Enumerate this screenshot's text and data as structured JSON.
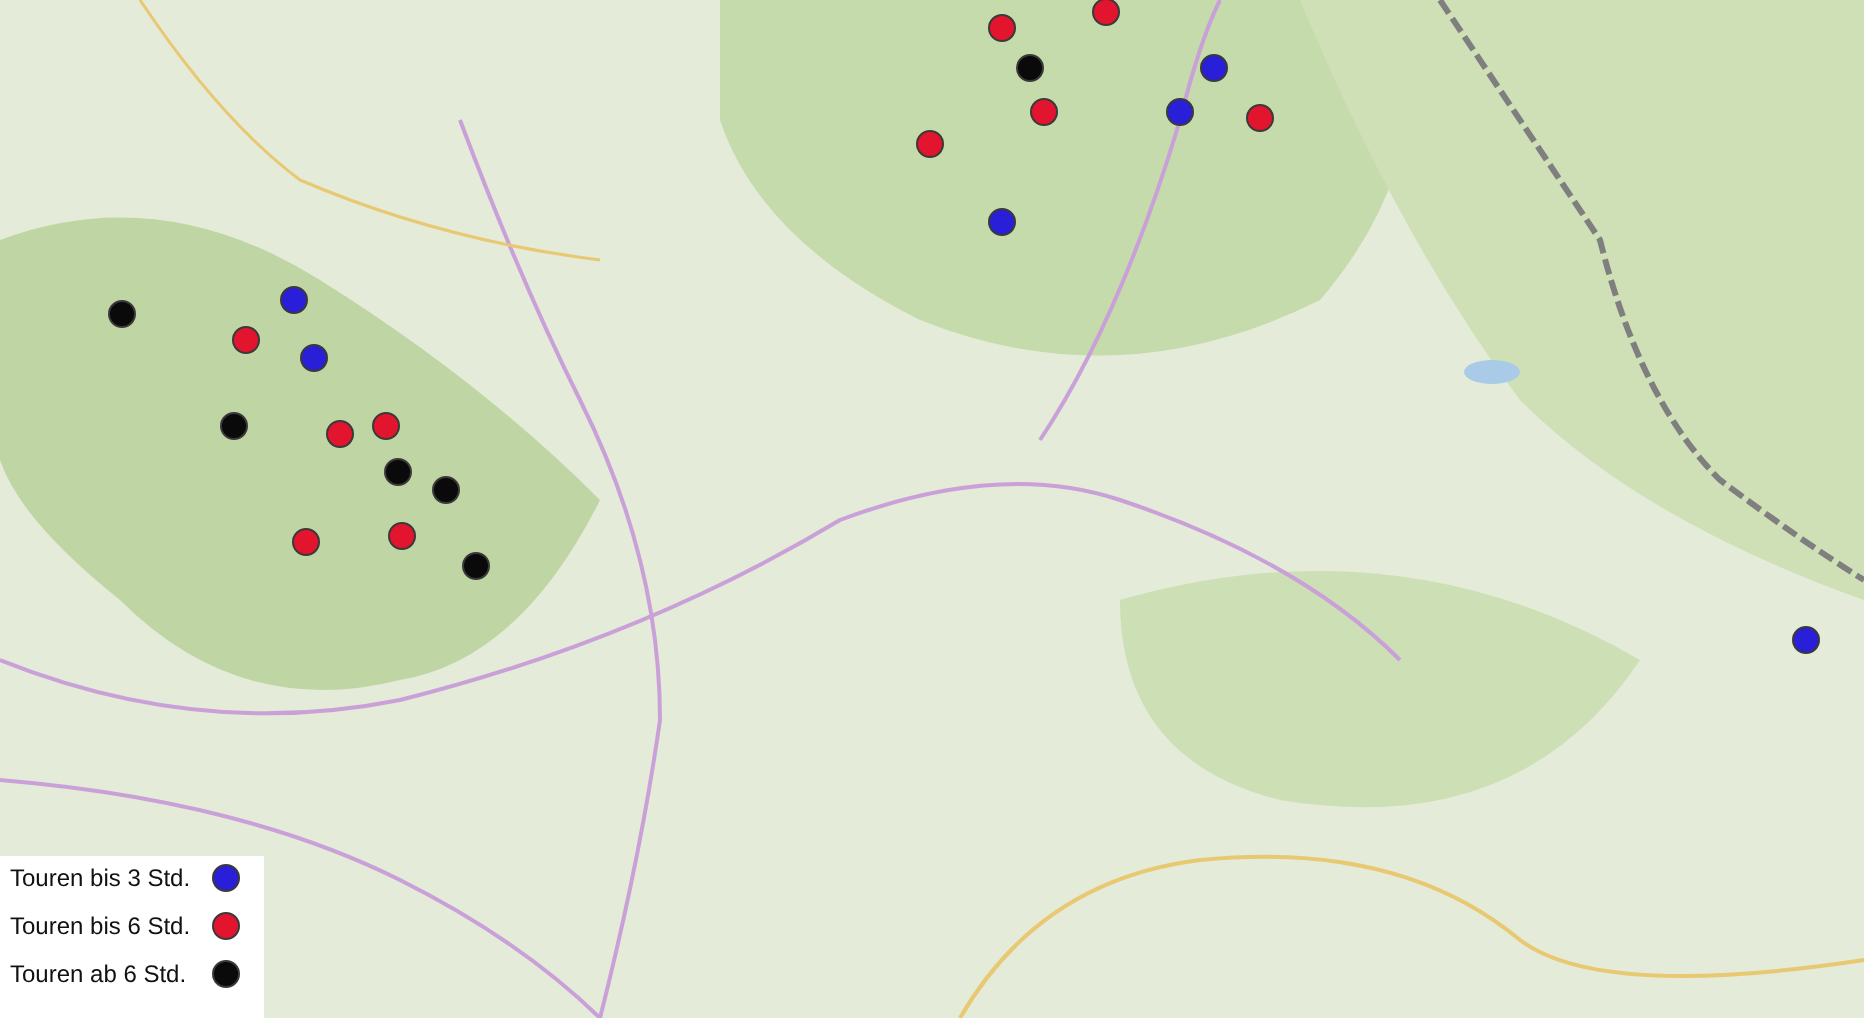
{
  "map": {
    "markers": [
      {
        "color": "#2a1fd8"
      },
      {
        "color": "#2a1fd8"
      },
      {
        "color": "#2a1fd8"
      },
      {
        "color": "#2a1fd8"
      },
      {
        "color": "#2a1fd8"
      },
      {
        "color": "#2a1fd8"
      },
      {
        "color": "#e3142d"
      },
      {
        "color": "#e3142d"
      },
      {
        "color": "#e3142d"
      },
      {
        "color": "#e3142d"
      },
      {
        "color": "#e3142d"
      },
      {
        "color": "#e3142d"
      },
      {
        "color": "#e3142d"
      },
      {
        "color": "#e3142d"
      },
      {
        "color": "#e3142d"
      },
      {
        "color": "#e3142d"
      },
      {
        "color": "#0a0a0a"
      },
      {
        "color": "#0a0a0a"
      },
      {
        "color": "#0a0a0a"
      },
      {
        "color": "#0a0a0a"
      },
      {
        "color": "#0a0a0a"
      },
      {
        "color": "#0a0a0a"
      }
    ]
  },
  "legend": {
    "items": [
      {
        "label": "Touren bis 3 Std.",
        "color": "#2a1fd8"
      },
      {
        "label": "Touren bis 6 Std.",
        "color": "#e3142d"
      },
      {
        "label": "Touren ab 6 Std.",
        "color": "#0a0a0a"
      }
    ]
  }
}
